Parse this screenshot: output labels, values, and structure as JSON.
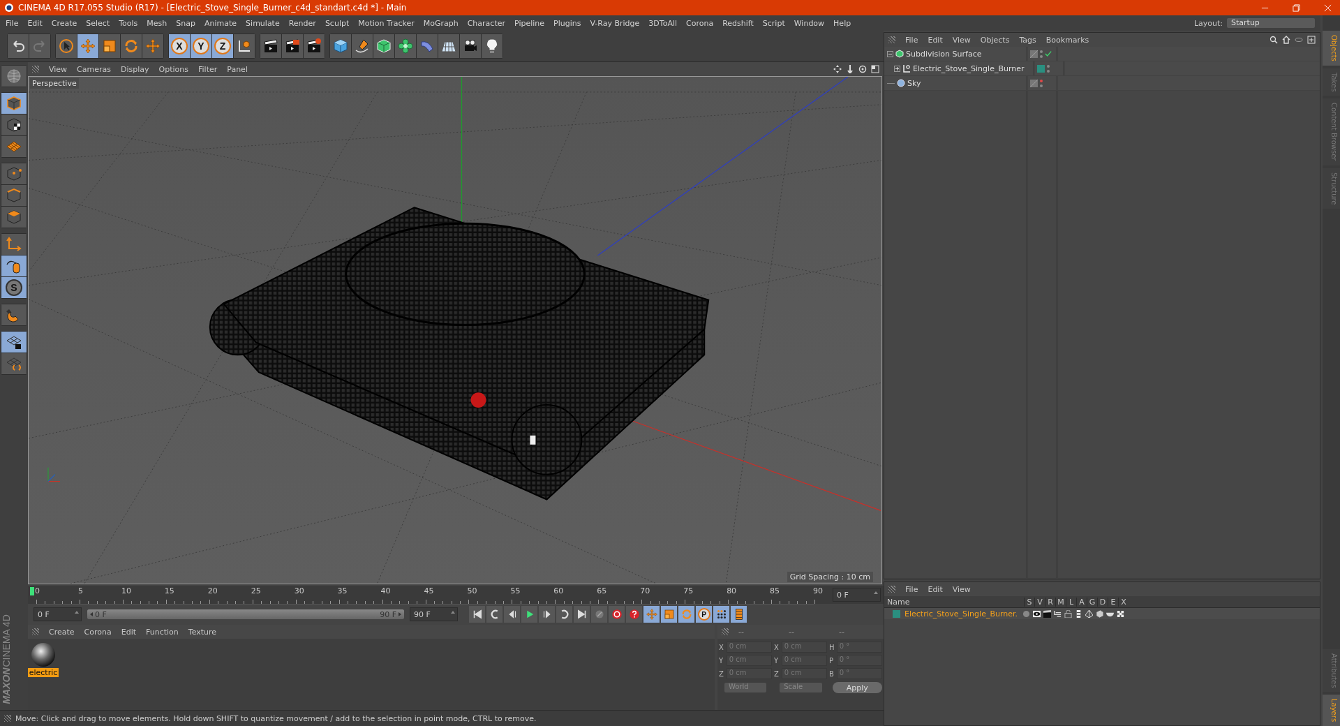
{
  "window": {
    "title": "CINEMA 4D R17.055 Studio (R17) - [Electric_Stove_Single_Burner_c4d_standart.c4d *] - Main"
  },
  "menu": [
    "File",
    "Edit",
    "Create",
    "Select",
    "Tools",
    "Mesh",
    "Snap",
    "Animate",
    "Simulate",
    "Render",
    "Sculpt",
    "Motion Tracker",
    "MoGraph",
    "Character",
    "Pipeline",
    "Plugins",
    "V-Ray Bridge",
    "3DToAll",
    "Corona",
    "Redshift",
    "Script",
    "Window",
    "Help"
  ],
  "layout": {
    "label": "Layout:",
    "value": "Startup"
  },
  "toolbar": [
    [
      {
        "kind": "undo",
        "selected": false
      },
      {
        "kind": "redo",
        "selected": false
      }
    ],
    [
      {
        "kind": "select",
        "selected": false
      },
      {
        "kind": "move",
        "selected": true
      },
      {
        "kind": "scale",
        "selected": false
      },
      {
        "kind": "rotate",
        "selected": false
      },
      {
        "kind": "move",
        "selected": false
      }
    ],
    [
      {
        "kind": "axis",
        "label": "X",
        "selected": true
      },
      {
        "kind": "axis",
        "label": "Y",
        "selected": true
      },
      {
        "kind": "axis",
        "label": "Z",
        "selected": true
      },
      {
        "kind": "coords",
        "selected": false
      }
    ],
    [
      {
        "kind": "clapper",
        "selected": false
      },
      {
        "kind": "clapper-play",
        "selected": false
      },
      {
        "kind": "clapper-gear",
        "selected": false
      }
    ],
    [
      {
        "kind": "cube",
        "selected": false
      },
      {
        "kind": "pen",
        "selected": false
      },
      {
        "kind": "subdiv",
        "selected": false
      },
      {
        "kind": "cloner",
        "selected": false
      },
      {
        "kind": "bend",
        "selected": false
      },
      {
        "kind": "floor",
        "selected": false
      },
      {
        "kind": "camera",
        "selected": false
      },
      {
        "kind": "light",
        "selected": false
      }
    ]
  ],
  "left_tools": [
    [
      {
        "kind": "globe",
        "selected": false
      }
    ],
    [
      {
        "kind": "model",
        "selected": true
      },
      {
        "kind": "texture",
        "selected": false
      },
      {
        "kind": "workplane",
        "selected": false
      }
    ],
    [
      {
        "kind": "points",
        "selected": false
      },
      {
        "kind": "edges",
        "selected": false
      },
      {
        "kind": "polygons",
        "selected": false
      }
    ],
    [
      {
        "kind": "axis-mode",
        "selected": false
      },
      {
        "kind": "tweak",
        "selected": true
      },
      {
        "kind": "solo",
        "label": "S",
        "selected": true
      }
    ],
    [
      {
        "kind": "magnet",
        "selected": false
      }
    ],
    [
      {
        "kind": "grid-lock",
        "selected": true
      },
      {
        "kind": "grid-rotate",
        "selected": false
      }
    ]
  ],
  "logo": {
    "brand": "MAXON",
    "product": "CINEMA 4D"
  },
  "viewport": {
    "menu": [
      "View",
      "Cameras",
      "Display",
      "Options",
      "Filter",
      "Panel"
    ],
    "camera": "Perspective",
    "grid_spacing": "Grid Spacing : 10 cm"
  },
  "timeline": {
    "ticks": [
      "0",
      "5",
      "10",
      "15",
      "20",
      "25",
      "30",
      "35",
      "40",
      "45",
      "50",
      "55",
      "60",
      "65",
      "70",
      "75",
      "80",
      "85",
      "90"
    ],
    "level": 0,
    "current": "0 F",
    "start": "0 F",
    "range": {
      "start": "0 F",
      "end": "90 F",
      "level": 1
    },
    "end": "90 F"
  },
  "transport": [
    {
      "kind": "first",
      "selected": false
    },
    {
      "kind": "prev-key",
      "selected": false
    },
    {
      "kind": "prev",
      "selected": false
    },
    {
      "kind": "play",
      "selected": false
    },
    {
      "kind": "next",
      "selected": false
    },
    {
      "kind": "next-key",
      "selected": false
    },
    {
      "kind": "last",
      "selected": false
    },
    {
      "kind": "record",
      "selected": false
    },
    {
      "kind": "autokey",
      "selected": false
    },
    {
      "kind": "keyhelp",
      "selected": false
    },
    {
      "kind": "move",
      "selected": true
    },
    {
      "kind": "scale",
      "selected": true
    },
    {
      "kind": "rotate",
      "selected": true
    },
    {
      "kind": "param",
      "label": "P",
      "selected": true
    },
    {
      "kind": "pla",
      "selected": true
    },
    {
      "kind": "film",
      "selected": true
    }
  ],
  "materials": {
    "menu": [
      "Create",
      "Corona",
      "Edit",
      "Function",
      "Texture"
    ],
    "items": [
      {
        "name": "electric",
        "selected": true
      }
    ]
  },
  "coordinates": {
    "headers": [
      "--",
      "--",
      "--"
    ],
    "rows": [
      {
        "axis": "X",
        "position": "0 cm",
        "size_axis": "X",
        "size": "0 cm",
        "rot_axis": "H",
        "rotation": "0 °"
      },
      {
        "axis": "Y",
        "position": "0 cm",
        "size_axis": "Y",
        "size": "0 cm",
        "rot_axis": "P",
        "rotation": "0 °"
      },
      {
        "axis": "Z",
        "position": "0 cm",
        "size_axis": "Z",
        "size": "0 cm",
        "rot_axis": "B",
        "rotation": "0 °"
      }
    ],
    "space": "World",
    "mode": "Scale",
    "apply": "Apply"
  },
  "objects": {
    "menu": [
      "File",
      "Edit",
      "View",
      "Objects",
      "Tags",
      "Bookmarks"
    ],
    "tree": [
      {
        "name": "Subdivision Surface",
        "kind": "subdiv",
        "expanded": true,
        "editor_visible": true,
        "enabled": true,
        "children": [
          {
            "name": "Electric_Stove_Single_Burner",
            "kind": "null-object",
            "expanded": false,
            "color": "#2a8f80",
            "editor_visible": true
          }
        ]
      },
      {
        "name": "Sky",
        "kind": "sky",
        "editor_visible": false
      }
    ]
  },
  "layers": {
    "menu": [
      "File",
      "Edit",
      "View"
    ],
    "columns": [
      "Name",
      "S",
      "V",
      "R",
      "M",
      "L",
      "A",
      "G",
      "D",
      "E",
      "X"
    ],
    "rows": [
      {
        "name": "Electric_Stove_Single_Burner.",
        "color": "#2a8f80"
      }
    ]
  },
  "side_tabs_top": [
    {
      "label": "Objects",
      "selected": true
    },
    {
      "label": "Takes",
      "selected": false
    },
    {
      "label": "Content Browser",
      "selected": false
    },
    {
      "label": "Structure",
      "selected": false
    }
  ],
  "side_tabs_bottom": [
    {
      "label": "Attributes",
      "selected": false
    },
    {
      "label": "Layers",
      "selected": true
    }
  ],
  "status_bar": "Move: Click and drag to move elements. Hold down SHIFT to quantize movement / add to the selection in point mode, CTRL to remove."
}
